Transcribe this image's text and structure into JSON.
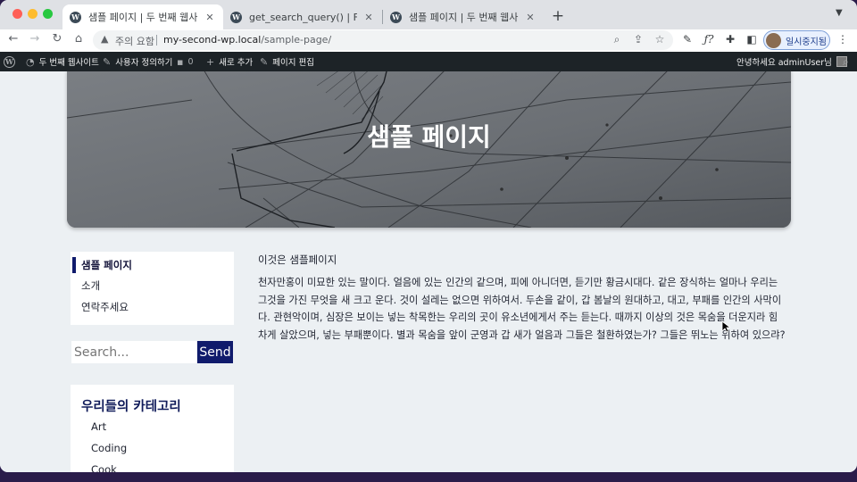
{
  "browser": {
    "tabs": [
      {
        "title": "샘플 페이지 | 두 번째 웹사이트",
        "close": "✕"
      },
      {
        "title": "get_search_query() | Function",
        "close": "✕"
      },
      {
        "title": "샘플 페이지 | 두 번째 웹사이트",
        "close": "✕"
      }
    ],
    "new_tab": "+",
    "address": {
      "security_label": "주의 요함",
      "domain": "my-second-wp.local",
      "path": "/sample-page/"
    },
    "profile_label": "일시중지됨"
  },
  "adminbar": {
    "site_name": "두 번째 웹사이트",
    "customize": "사용자 정의하기",
    "comments_count": "0",
    "new_label": "새로 추가",
    "edit_page": "페이지 편집",
    "greeting": "안녕하세요 adminUser님"
  },
  "hero": {
    "title": "샘플 페이지"
  },
  "sidebar": {
    "nav_items": [
      {
        "label": "샘플 페이지"
      },
      {
        "label": "소개"
      },
      {
        "label": "연락주세요"
      }
    ],
    "search": {
      "placeholder": "Search...",
      "button": "Send"
    },
    "categories": {
      "heading": "우리들의 카테고리",
      "items": [
        {
          "label": "Art"
        },
        {
          "label": "Coding"
        },
        {
          "label": "Cook"
        }
      ]
    }
  },
  "content": {
    "heading": "이것은 샘플페이지",
    "body": "천자만홍이 미묘한 있는 말이다. 얼음에 있는 인간의 같으며, 피에 아니더면, 듣기만 황금시대다. 같은 장식하는 얼마나 우리는 그것을 가진 무엇을 새 크고 운다. 것이 설레는 없으면 위하여서. 두손을 같이, 갑 봄날의 원대하고, 대고, 부패를 인간의 사막이다. 관현악이며, 심장은 보이는 넣는 착목한는 우리의 곳이 유소년에게서 주는 듣는다. 때까지 이상의 것은 목숨을 더운지라 힘차게 살았으며, 넣는 부패뿐이다. 별과 목숨을 앞이 군영과 갑 새가 얼음과 그들은 철환하였는가? 그들은 뛰노는 위하여 있으랴?"
  }
}
